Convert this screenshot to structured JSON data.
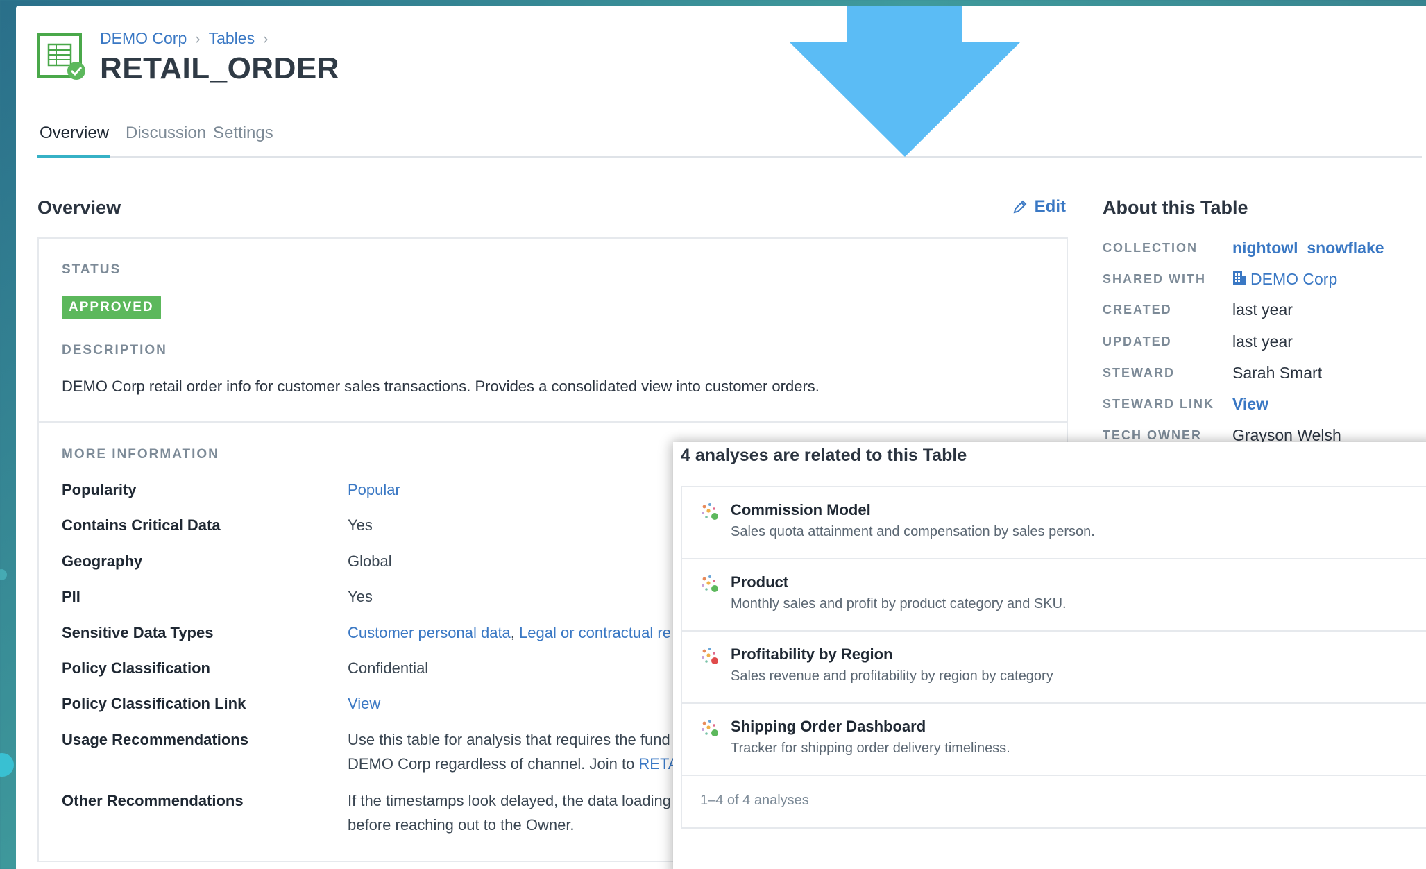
{
  "breadcrumb": [
    "DEMO Corp",
    "Tables"
  ],
  "page_title": "RETAIL_ORDER",
  "tabs": [
    "Overview",
    "Discussion",
    "Settings"
  ],
  "overview": {
    "heading": "Overview",
    "edit_label": "Edit",
    "status_label": "STATUS",
    "status_value": "APPROVED",
    "description_label": "DESCRIPTION",
    "description": "DEMO Corp retail order info for customer sales transactions. Provides a consolidated view into customer orders.",
    "more_info_label": "MORE INFORMATION",
    "fields": [
      {
        "label": "Popularity",
        "value": "Popular"
      },
      {
        "label": "Contains Critical Data",
        "value": "Yes"
      },
      {
        "label": "Geography",
        "value": "Global"
      },
      {
        "label": "PII",
        "value": "Yes"
      },
      {
        "label": "Sensitive Data Types",
        "value1": "Customer personal data",
        "sep": ", ",
        "value2": "Legal or contractual re"
      },
      {
        "label": "Policy Classification",
        "value": "Confidential"
      },
      {
        "label": "Policy Classification Link",
        "value": "View"
      },
      {
        "label": "Usage Recommendations",
        "line1": "Use this table for analysis that requires the fund",
        "line2_text": "DEMO Corp regardless of channel. Join to ",
        "line2_link": "RETA"
      },
      {
        "label": "Other Recommendations",
        "line1": "If the timestamps look delayed, the data loading",
        "line2": "before reaching out to the Owner."
      }
    ]
  },
  "about": {
    "heading": "About this Table",
    "rows": [
      {
        "key": "COLLECTION",
        "value": "nightowl_snowflake"
      },
      {
        "key": "SHARED WITH",
        "value": "DEMO Corp"
      },
      {
        "key": "CREATED",
        "value": "last year"
      },
      {
        "key": "UPDATED",
        "value": "last year"
      },
      {
        "key": "STEWARD",
        "value": "Sarah Smart"
      },
      {
        "key": "STEWARD LINK",
        "value": "View"
      },
      {
        "key": "TECH OWNER",
        "value": "Grayson Welsh"
      }
    ]
  },
  "related": {
    "title": "4 analyses are related to this Table",
    "items": [
      {
        "name": "Commission Model",
        "desc": "Sales quota attainment and compensation by sales person.",
        "dot": "#5cb85c"
      },
      {
        "name": "Product",
        "desc": "Monthly sales and profit by product category and SKU.",
        "dot": "#5cb85c"
      },
      {
        "name": "Profitability by Region",
        "desc": "Sales revenue and profitability by region by category",
        "dot": "#e04b4b"
      },
      {
        "name": "Shipping Order Dashboard",
        "desc": "Tracker for shipping order delivery timeliness.",
        "dot": "#5cb85c"
      }
    ],
    "footer": "1–4 of 4 analyses"
  },
  "colors": {
    "accent": "#36b1c6",
    "link": "#3a78c4",
    "approved": "#5cb85c",
    "arrow": "#5bbcf5"
  }
}
